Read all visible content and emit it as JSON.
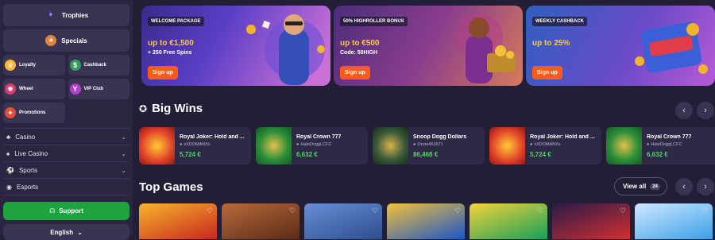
{
  "sidebar": {
    "big": [
      {
        "label": "Trophies",
        "icon": "trophy-icon",
        "glyph": "🏆"
      },
      {
        "label": "Specials",
        "icon": "special-gifts-icon",
        "glyph": "🎁"
      }
    ],
    "grid": [
      {
        "label": "Loyalty",
        "icon": "loyalty-icon",
        "glyph": "👑",
        "bg": "#ffb52e"
      },
      {
        "label": "Cashback",
        "icon": "cashback-icon",
        "glyph": "💰",
        "bg": "#2f9f5b"
      },
      {
        "label": "Wheel",
        "icon": "wheel-icon",
        "glyph": "🎡",
        "bg": "#d63d6b"
      },
      {
        "label": "VIP Club",
        "icon": "vip-icon",
        "glyph": "🍸",
        "bg": "#b23ec9"
      },
      {
        "label": "Promotions",
        "icon": "promotions-icon",
        "glyph": "🎈",
        "bg": "#e24c3c"
      }
    ],
    "rows": [
      {
        "label": "Casino",
        "icon": "casino-icon",
        "glyph": "♣"
      },
      {
        "label": "Live Casino",
        "icon": "live-casino-icon",
        "glyph": "♠"
      },
      {
        "label": "Sports",
        "icon": "sports-icon",
        "glyph": "⚽"
      },
      {
        "label": "Esports",
        "icon": "esports-icon",
        "glyph": "🎮"
      }
    ],
    "support_label": "Support",
    "language_label": "English"
  },
  "banners": [
    {
      "tag": "WELCOME PACKAGE",
      "headline": "up to €1,500",
      "sub": "+ 250 Free Spins",
      "button": "Sign up"
    },
    {
      "tag": "50% HIGHROLLER BONUS",
      "headline": "up to €500",
      "sub": "Code: 50HIGH",
      "button": "Sign up"
    },
    {
      "tag": "WEEKLY CASHBACK",
      "headline": "up to 25%",
      "sub": "",
      "button": "Sign up"
    }
  ],
  "big_wins": {
    "title": "Big Wins",
    "items": [
      {
        "game": "Royal Joker: Hold and ...",
        "user": "xXDOMANXx",
        "amount": "5,724 €",
        "theme": "joker"
      },
      {
        "game": "Royal Crown 777",
        "user": "HateDoggLCFC",
        "amount": "6,632 €",
        "theme": "crown"
      },
      {
        "game": "Snoop Dogg Dollars",
        "user": "Ozzie452671",
        "amount": "86,468 €",
        "theme": "snoop"
      },
      {
        "game": "Royal Joker: Hold and ...",
        "user": "xXDOMANXx",
        "amount": "5,724 €",
        "theme": "joker"
      },
      {
        "game": "Royal Crown 777",
        "user": "HateDoggLCFC",
        "amount": "6,632 €",
        "theme": "crown"
      }
    ]
  },
  "top_games": {
    "title": "Top Games",
    "view_all": "View all",
    "count": "24",
    "tiles": [
      "#c8261f",
      "#5a2b17",
      "#2d4f8f",
      "#1a55c8",
      "#16a05a",
      "#d22f2f",
      "#3aa0e8"
    ]
  },
  "colors": {
    "support_green": "#1fa33f",
    "signup_orange": "#ff5b16",
    "amount_green": "#4cd964",
    "headline_yellow": "#ffc83d"
  }
}
